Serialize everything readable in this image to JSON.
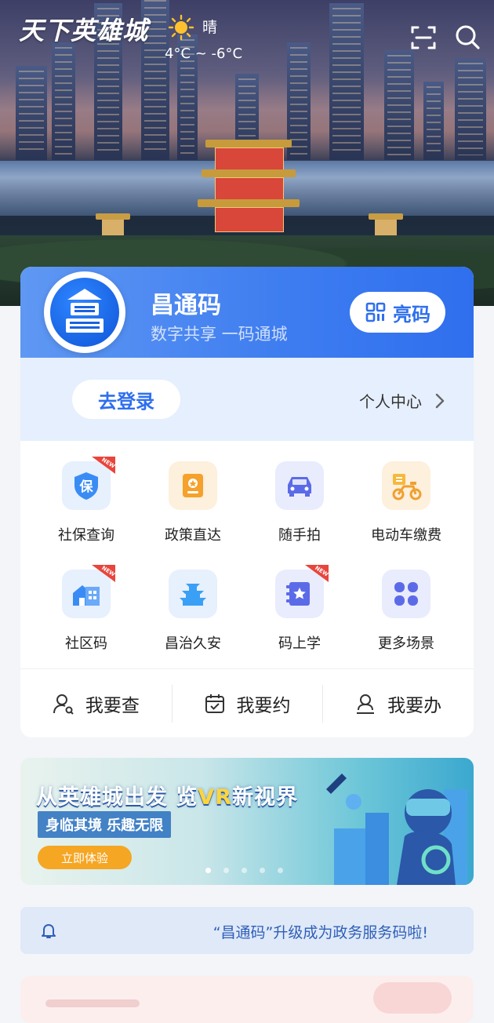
{
  "header": {
    "logo_text": "天下英雄城",
    "weather": "晴",
    "temperature": "4°C ~ -6°C",
    "scan_icon": "scan-icon",
    "search_icon": "search-icon"
  },
  "code_card": {
    "title": "昌通码",
    "subtitle": "数字共享 一码通城",
    "light_button": "亮码",
    "login_button": "去登录",
    "personal_center": "个人中心"
  },
  "services": [
    {
      "label": "社保查询",
      "icon": "social-security-icon",
      "new": true
    },
    {
      "label": "政策直达",
      "icon": "policy-icon",
      "new": false
    },
    {
      "label": "随手拍",
      "icon": "car-camera-icon",
      "new": false
    },
    {
      "label": "电动车缴费",
      "icon": "e-bike-icon",
      "new": false
    },
    {
      "label": "社区码",
      "icon": "community-icon",
      "new": true
    },
    {
      "label": "昌治久安",
      "icon": "pavilion-icon",
      "new": false
    },
    {
      "label": "码上学",
      "icon": "study-icon",
      "new": true
    },
    {
      "label": "更多场景",
      "icon": "more-icon",
      "new": false
    }
  ],
  "actions": [
    {
      "label": "我要查",
      "icon": "person-search-icon"
    },
    {
      "label": "我要约",
      "icon": "calendar-icon"
    },
    {
      "label": "我要办",
      "icon": "person-stamp-icon"
    }
  ],
  "banner": {
    "title_pre": "从英雄城出发 览",
    "title_vr": "VR",
    "title_post": "新视界",
    "subtitle": "身临其境 乐趣无限",
    "button": "立即体验",
    "page_count": 5,
    "active_page": 1
  },
  "notice": {
    "text": "“昌通码”升级成为政务服务码啦!"
  },
  "colors": {
    "primary": "#2f6fee",
    "badge_red": "#e8453c",
    "banner_button": "#f5a623"
  }
}
